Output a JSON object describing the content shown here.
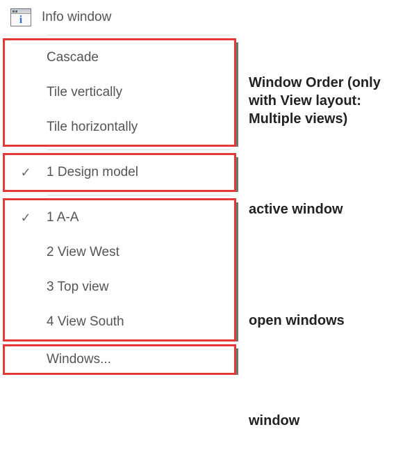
{
  "top_item": {
    "label": "Info window"
  },
  "group_order": {
    "items": [
      {
        "label": "Cascade"
      },
      {
        "label": "Tile vertically"
      },
      {
        "label": "Tile horizontally"
      }
    ],
    "annotation": "Window Order (only with View layout: Multiple views)"
  },
  "group_active": {
    "item": {
      "label": "1 Design model",
      "checked": true
    },
    "annotation": "active window"
  },
  "group_open": {
    "items": [
      {
        "label": "1 A-A",
        "checked": true
      },
      {
        "label": "2 View West",
        "checked": false
      },
      {
        "label": "3 Top view",
        "checked": false
      },
      {
        "label": "4 View South",
        "checked": false
      }
    ],
    "annotation": "open windows"
  },
  "group_windows": {
    "item": {
      "label": "Windows..."
    },
    "annotation": "window"
  }
}
